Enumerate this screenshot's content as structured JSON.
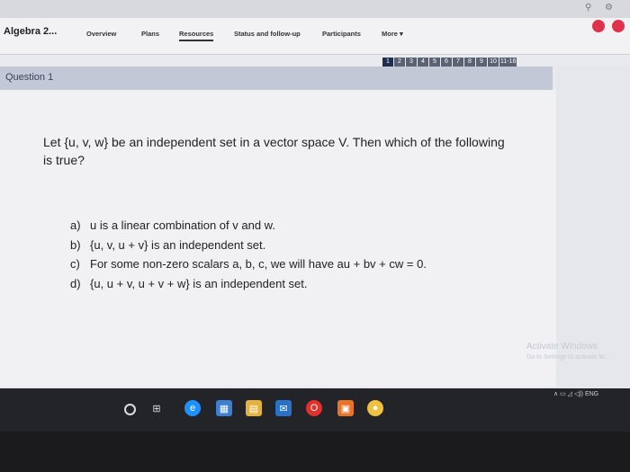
{
  "course": {
    "title": "Algebra 2..."
  },
  "nav": {
    "tabs": [
      {
        "label": "Overview"
      },
      {
        "label": "Plans"
      },
      {
        "label": "Resources"
      },
      {
        "label": "Status and follow-up"
      },
      {
        "label": "Participants"
      },
      {
        "label": "More ▾"
      }
    ]
  },
  "pager": [
    "1",
    "2",
    "3",
    "4",
    "5",
    "6",
    "7",
    "8",
    "9",
    "10",
    "11-16"
  ],
  "question": {
    "label": "Question 1",
    "line1": "Let {u, v, w} be an independent set in a vector space V. Then which of the following",
    "line2": "is true?",
    "options": [
      {
        "letter": "a)",
        "text": "u is a linear combination of v and w."
      },
      {
        "letter": "b)",
        "text": "{u, v, u + v} is an independent set."
      },
      {
        "letter": "c)",
        "text": "For some non-zero scalars a, b, c, we will have au + bv + cw = 0."
      },
      {
        "letter": "d)",
        "text": "{u, u + v, u + v + w} is an independent set."
      }
    ]
  },
  "watermark": {
    "line1": "Activate Windows",
    "line2": "Go to Settings to activate W..."
  },
  "tray": {
    "lang": "ENG"
  }
}
